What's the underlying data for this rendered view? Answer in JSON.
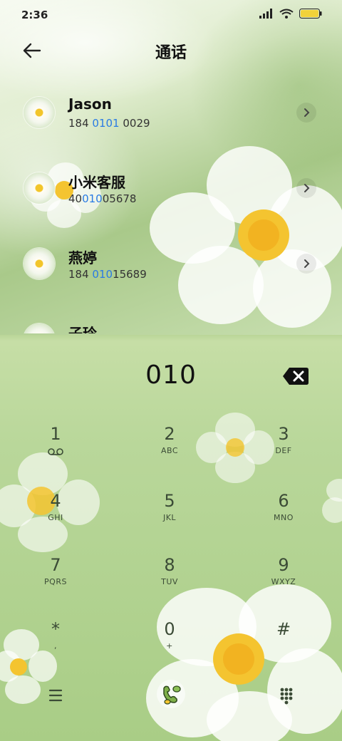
{
  "status": {
    "time": "2:36"
  },
  "header": {
    "title": "通话"
  },
  "contacts": [
    {
      "name": "Jason",
      "pre": "184 ",
      "hl": "0101",
      "post": " 0029"
    },
    {
      "name": "小米客服",
      "pre": "40",
      "hl": "010",
      "post": "05678"
    },
    {
      "name": "燕婷",
      "pre": "184 ",
      "hl": "010",
      "post": "15689"
    },
    {
      "name": "子玲",
      "pre": "",
      "hl": "",
      "post": ""
    }
  ],
  "dialer": {
    "input": "010",
    "keys": [
      {
        "num": "1",
        "letters": ""
      },
      {
        "num": "2",
        "letters": "ABC"
      },
      {
        "num": "3",
        "letters": "DEF"
      },
      {
        "num": "4",
        "letters": "GHI"
      },
      {
        "num": "5",
        "letters": "JKL"
      },
      {
        "num": "6",
        "letters": "MNO"
      },
      {
        "num": "7",
        "letters": "PQRS"
      },
      {
        "num": "8",
        "letters": "TUV"
      },
      {
        "num": "9",
        "letters": "WXYZ"
      },
      {
        "num": "*",
        "letters": ","
      },
      {
        "num": "0",
        "letters": "+"
      },
      {
        "num": "#",
        "letters": ""
      }
    ]
  },
  "icons": {
    "back": "arrow-left-icon",
    "delete": "backspace-icon",
    "menu": "menu-icon",
    "call": "call-button-icon",
    "keypad": "keypad-icon"
  }
}
